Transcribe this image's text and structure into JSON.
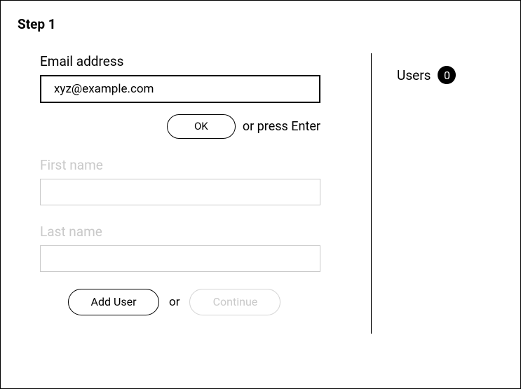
{
  "step": {
    "title": "Step 1"
  },
  "form": {
    "email": {
      "label": "Email address",
      "value": "xyz@example.com"
    },
    "ok_button": "OK",
    "enter_hint": "or press Enter",
    "first_name": {
      "label": "First name",
      "value": ""
    },
    "last_name": {
      "label": "Last name",
      "value": ""
    },
    "add_user_button": "Add User",
    "or_text": "or",
    "continue_button": "Continue"
  },
  "users": {
    "label": "Users",
    "count": "0"
  }
}
